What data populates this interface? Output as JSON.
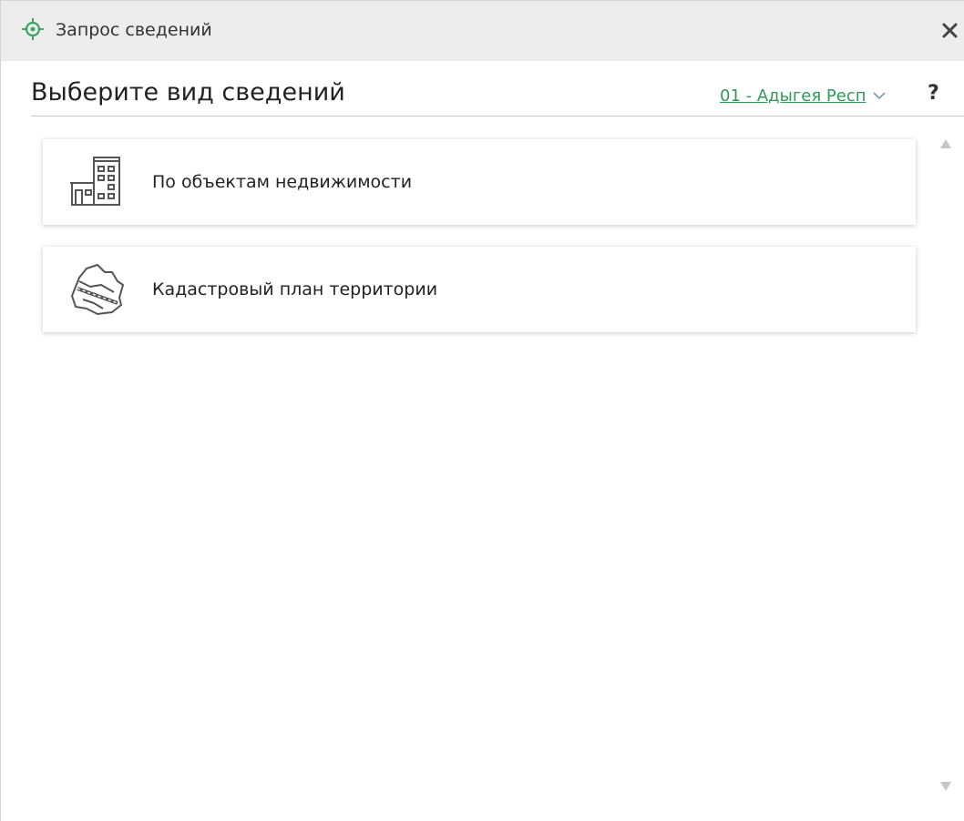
{
  "window": {
    "title": "Запрос сведений",
    "close_icon": "close-icon",
    "title_icon": "target-crosshair-icon"
  },
  "header": {
    "title": "Выберите вид сведений",
    "region_value": "01 - Адыгея Респ",
    "help_label": "?"
  },
  "cards": [
    {
      "label": "По объектам недвижимости",
      "icon": "buildings-icon"
    },
    {
      "label": "Кадастровый план территории",
      "icon": "cadastral-map-icon"
    }
  ],
  "colors": {
    "accent": "#2e9b57",
    "titlebar": "#ededed"
  }
}
